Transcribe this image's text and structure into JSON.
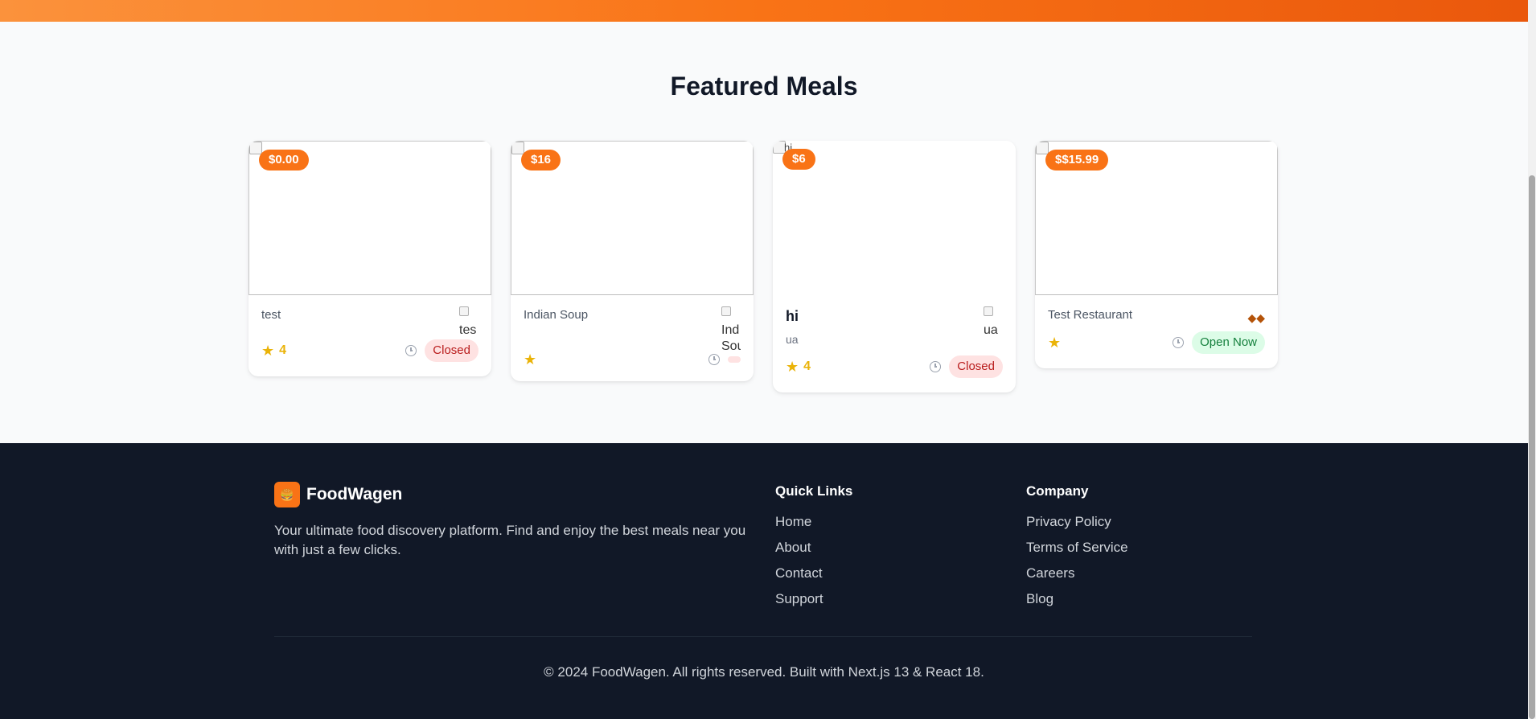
{
  "featured": {
    "title": "Featured Meals",
    "cards": [
      {
        "price": "$0.00",
        "image_alt": "",
        "name": "test",
        "logo_alt": "tes",
        "rating": "4",
        "status": "Closed"
      },
      {
        "price": "$16",
        "image_alt": "",
        "name": "Indian Soup",
        "logo_alt_line1": "Ind",
        "logo_alt_line2": "Sou",
        "rating": "",
        "status": ""
      },
      {
        "price": "$6",
        "image_alt": "hi",
        "name": "hi",
        "subtitle": "ua",
        "logo_alt": "ua",
        "rating": "4",
        "status": "Closed"
      },
      {
        "price": "$$15.99",
        "image_alt": "",
        "name": "Test Restaurant",
        "rating": "",
        "status": "Open Now"
      }
    ]
  },
  "footer": {
    "brand_name": "FoodWagen",
    "brand_logo_icon": "burger-emoji",
    "description": "Your ultimate food discovery platform. Find and enjoy the best meals near you with just a few clicks.",
    "quick_links": {
      "title": "Quick Links",
      "items": [
        "Home",
        "About",
        "Contact",
        "Support"
      ]
    },
    "company": {
      "title": "Company",
      "items": [
        "Privacy Policy",
        "Terms of Service",
        "Careers",
        "Blog"
      ]
    },
    "copyright": "© 2024 FoodWagen. All rights reserved. Built with Next.js 13 & React 18."
  },
  "colors": {
    "accent": "#f97316",
    "footer_bg": "#111827",
    "closed_bg": "#fee2e2",
    "closed_text": "#b91c1c",
    "open_bg": "#dcfce7",
    "open_text": "#15803d",
    "star": "#eab308"
  }
}
